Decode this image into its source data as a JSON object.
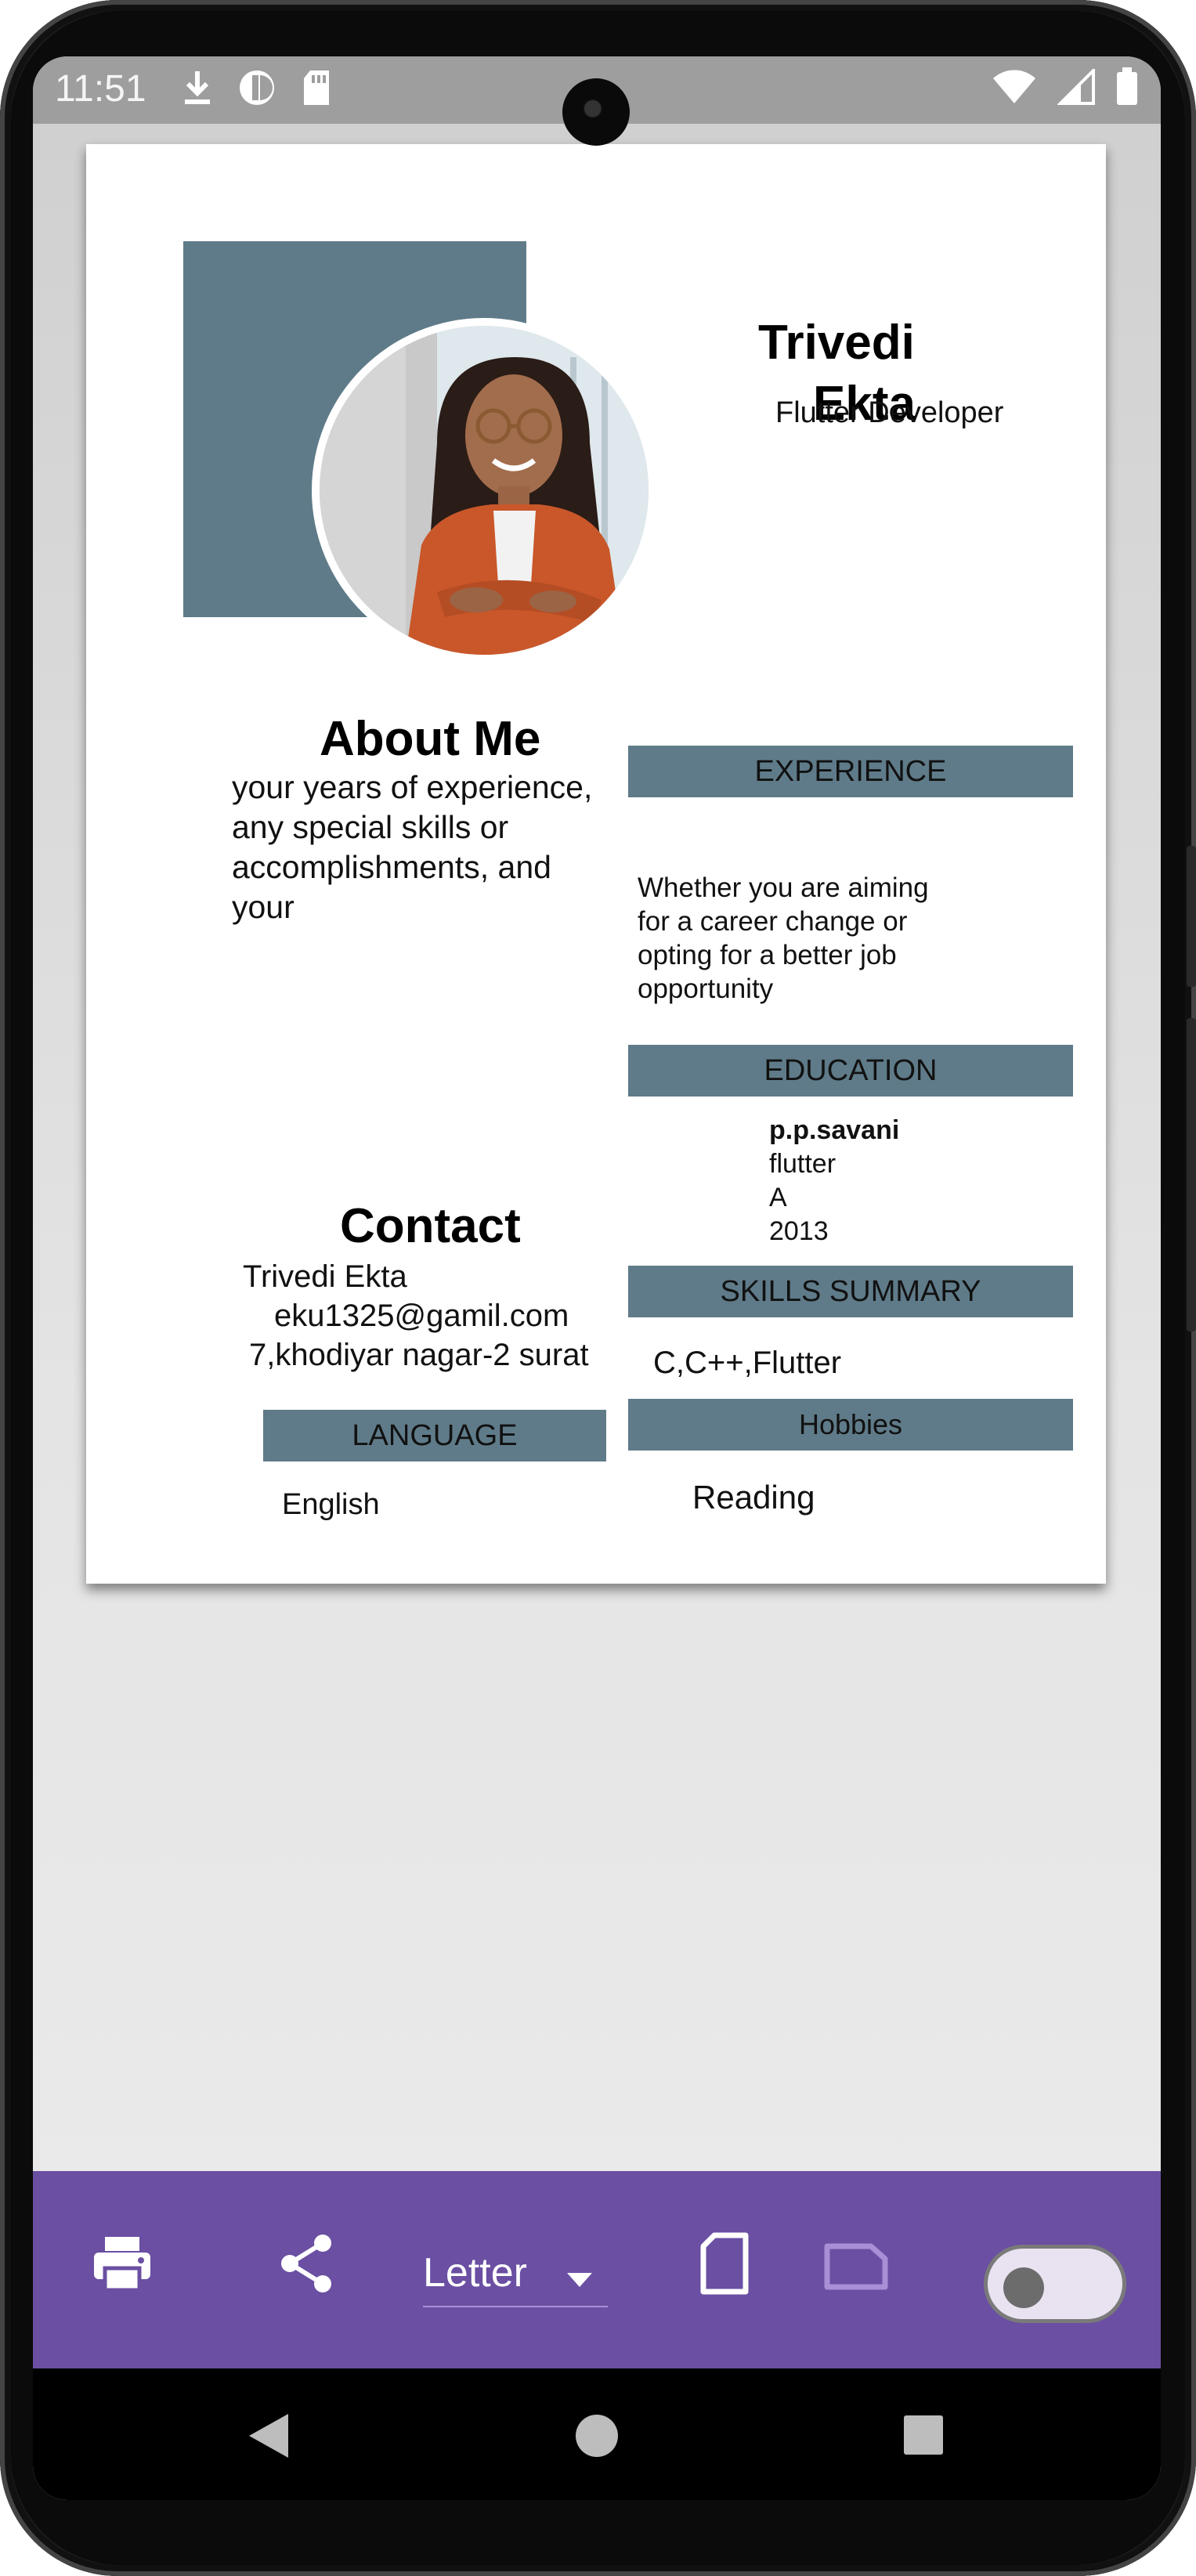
{
  "status_bar": {
    "time": "11:51",
    "left_icons": [
      "download-icon",
      "data-saver-icon",
      "sd-card-icon"
    ],
    "right_icons": [
      "wifi-icon",
      "signal-icon",
      "battery-icon"
    ]
  },
  "resume": {
    "first_name": "Trivedi",
    "last_name": "Ekta",
    "role": "Flutter Developer",
    "about": {
      "title": "About Me",
      "text": "your years of experience, any special skills or accomplishments, and your"
    },
    "experience": {
      "title": "EXPERIENCE",
      "text": "Whether you are aiming for a career change or opting for a better job opportunity"
    },
    "education": {
      "title": "EDUCATION",
      "school": "p.p.savani",
      "course": "flutter",
      "grade": "A",
      "year": "2013"
    },
    "skills": {
      "title": "SKILLS SUMMARY",
      "text": "C,C++,Flutter"
    },
    "hobbies": {
      "title": "Hobbies",
      "text": "Reading"
    },
    "contact": {
      "title": "Contact",
      "name": "Trivedi Ekta",
      "email": "eku1325@gamil.com",
      "address": "7,khodiyar nagar-2 surat"
    },
    "language": {
      "title": "LANGUAGE",
      "text": "English"
    }
  },
  "toolbar": {
    "paper_size": "Letter",
    "icons": [
      "print-icon",
      "share-icon",
      "portrait-icon",
      "landscape-icon"
    ],
    "toggle_on": false,
    "background": "#6a4fa3"
  },
  "colors": {
    "accent_bar": "#5f7b89",
    "toolbar": "#6a4fa3"
  }
}
